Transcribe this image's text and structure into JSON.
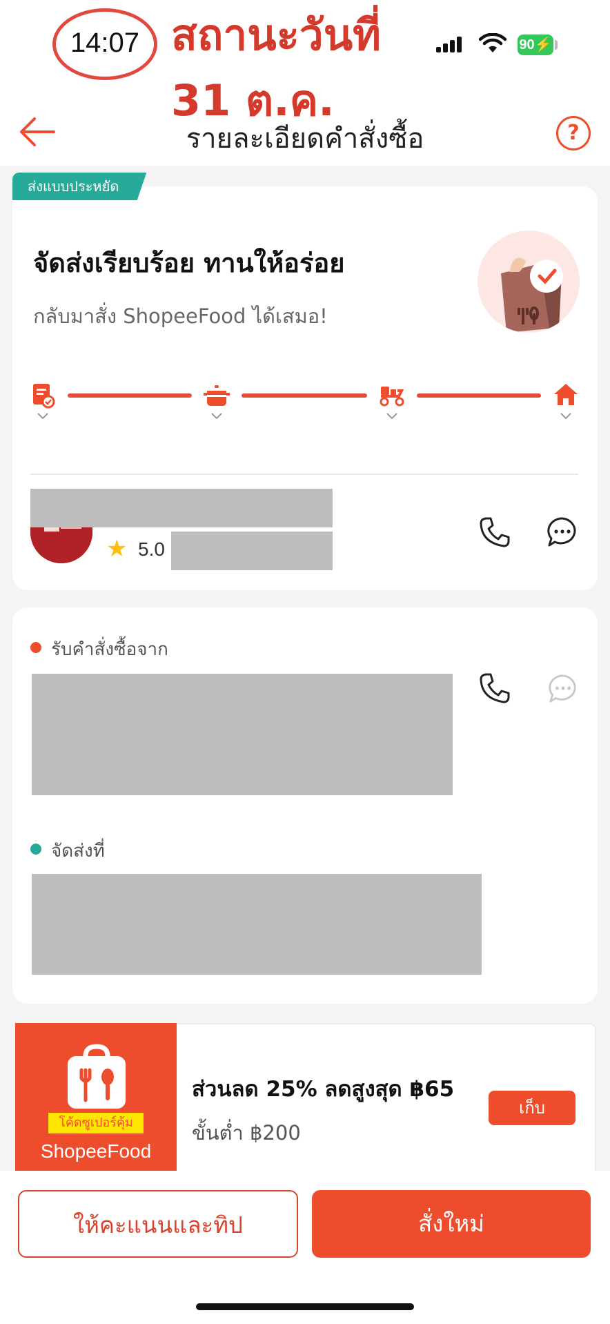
{
  "status_bar": {
    "time": "14:07",
    "battery": "90"
  },
  "annotation": {
    "line1": "สถานะวันที่",
    "line2": "31 ต.ค."
  },
  "nav": {
    "title": "รายละเอียดคำสั่งซื้อ",
    "help": "?"
  },
  "delivery_status": {
    "badge": "ส่งแบบประหยัด",
    "title": "จัดส่งเรียบร้อย ทานให้อร่อย",
    "subtitle": "กลับมาสั่ง ShopeeFood ได้เสมอ!",
    "steps": [
      "order-confirmed",
      "cooking",
      "delivering",
      "delivered"
    ],
    "progress": 1.0
  },
  "driver": {
    "rating": "5.0"
  },
  "order_info": {
    "pickup_label": "รับคำสั่งซื้อจาก",
    "dropoff_label": "จัดส่งที่"
  },
  "voucher": {
    "tag": "โค้ดซูเปอร์คุ้ม",
    "brand": "ShopeeFood",
    "title": "ส่วนลด 25% ลดสูงสุด ฿65",
    "subtitle": "ขั้นต่ำ ฿200",
    "button": "เก็บ"
  },
  "actions": {
    "rate_tip": "ให้คะแนนและทิป",
    "reorder": "สั่งใหม่"
  },
  "colors": {
    "accent": "#ee4d2d",
    "teal": "#26aa99",
    "annotation": "#d33a2c"
  }
}
